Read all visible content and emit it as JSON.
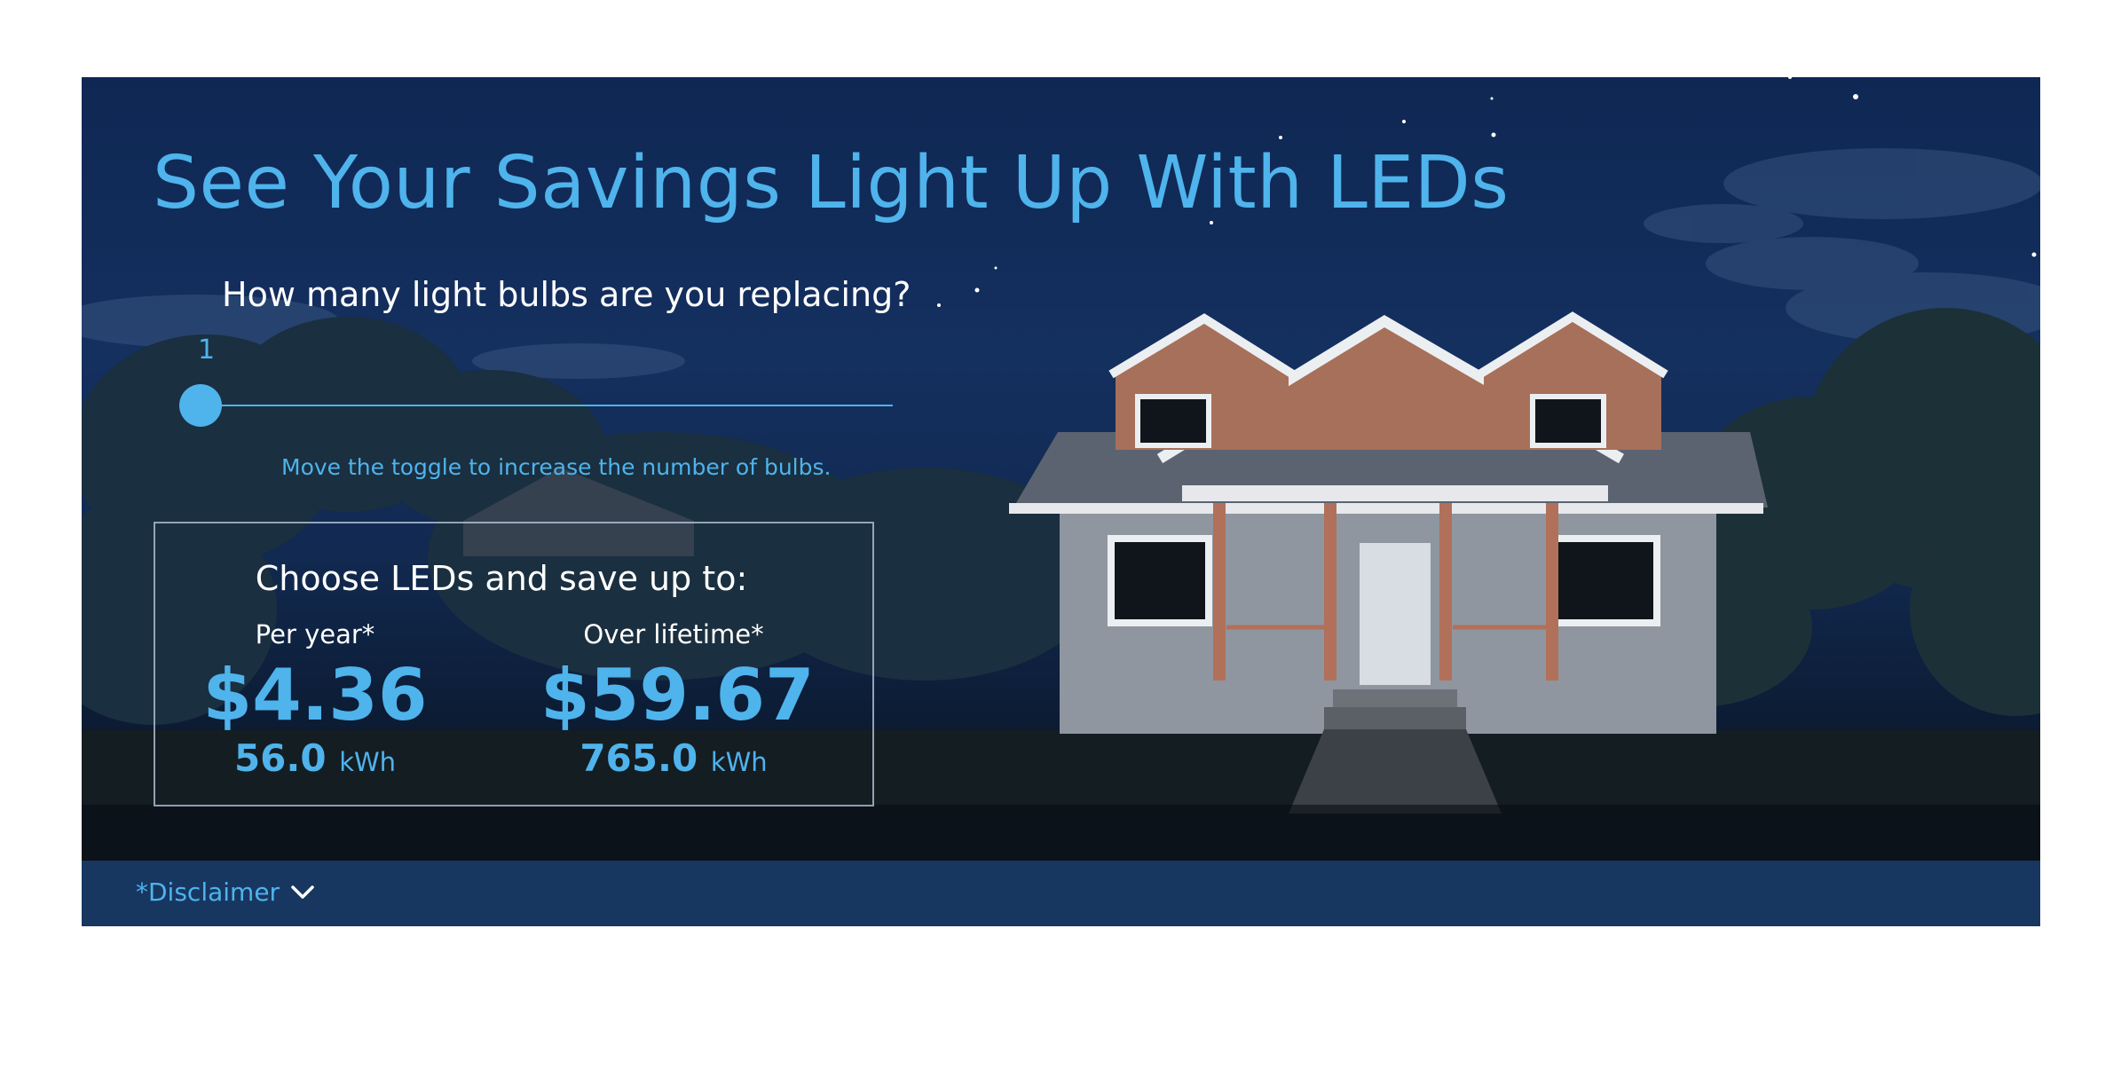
{
  "banner": {
    "title": "See Your Savings Light Up With LEDs",
    "question": "How many light bulbs are you replacing?",
    "slider": {
      "value": "1",
      "level": 0
    },
    "hint": "Move the toggle to increase the number of bulbs.",
    "background_icon": "night-house-illustration"
  },
  "savings": {
    "heading": "Choose LEDs and save up to:",
    "per_year": {
      "label": "Per year*",
      "amount": "$4.36",
      "kwh_value": "56.0",
      "kwh_unit": "kWh"
    },
    "lifetime": {
      "label": "Over lifetime*",
      "amount": "$59.67",
      "kwh_value": "765.0",
      "kwh_unit": "kWh"
    }
  },
  "footer": {
    "disclaimer_label": "*Disclaimer",
    "disclaimer_icon": "chevron-down-icon"
  },
  "colors": {
    "accent": "#4fb3ec",
    "banner_bg": "#14305f",
    "footer_bg": "#173761",
    "text": "#ffffff"
  }
}
